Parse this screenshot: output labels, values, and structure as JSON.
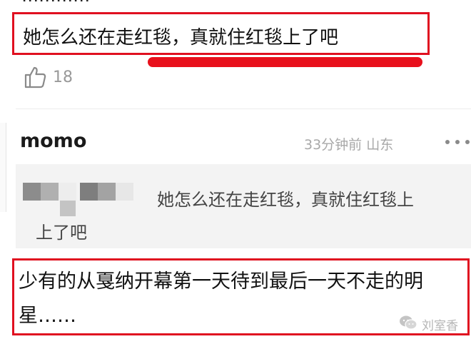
{
  "comments": [
    {
      "text": "她怎么还在走红毯，真就住红毯上了吧",
      "likes": "18"
    },
    {
      "username": "momo",
      "meta": "33分钟前 山东",
      "quote": {
        "line1": "她怎么还在走红毯，真就住红毯上",
        "line2": "上了吧"
      },
      "text": "少有的从戛纳开幕第一天待到最后一天不走的明星……"
    }
  ],
  "icons": {
    "like": "thumb-up-icon",
    "more": "more-dots-icon",
    "watermark": "wechat-icon"
  },
  "watermark": {
    "text": "刘室香"
  },
  "colors": {
    "highlight_box": "#e01020",
    "underline": "#e8101c",
    "muted_text": "#a8a8a8",
    "quote_bg": "#f3f3f3"
  }
}
